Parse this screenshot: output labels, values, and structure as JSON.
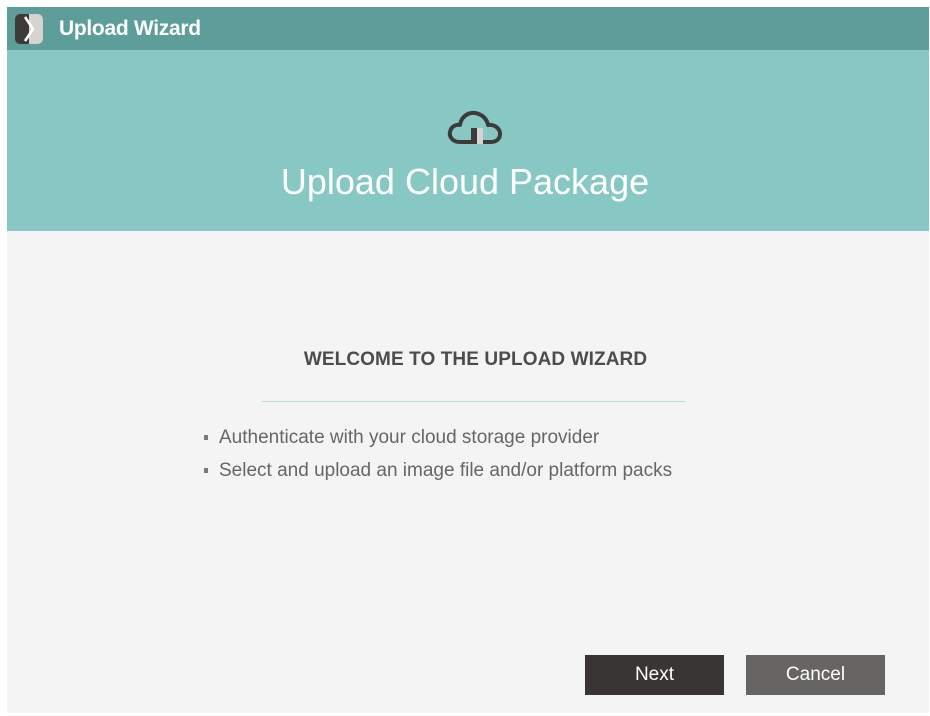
{
  "window": {
    "title": "Upload Wizard",
    "icon": "app-chevron-logo"
  },
  "banner": {
    "icon": "cloud-upload-icon",
    "title": "Upload Cloud Package"
  },
  "content": {
    "heading": "WELCOME TO THE UPLOAD WIZARD",
    "bullets": [
      "Authenticate with your cloud storage provider",
      "Select and upload an image file and/or platform packs"
    ]
  },
  "buttons": {
    "next_label": "Next",
    "cancel_label": "Cancel"
  },
  "colors": {
    "titlebar": "#5e9e9a",
    "banner": "#87c8c5",
    "body": "#f4f4f4",
    "next_button": "#383534",
    "cancel_button": "#666564"
  }
}
